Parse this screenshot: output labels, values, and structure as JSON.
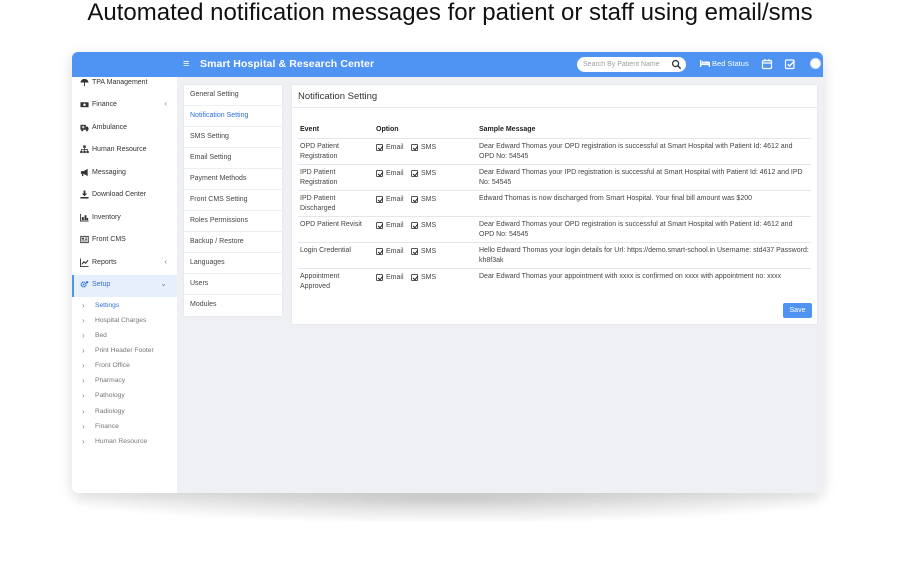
{
  "headline": "Automated notification messages for patient or staff using email/sms",
  "app": {
    "title": "Smart Hospital & Research Center",
    "search_placeholder": "Search By Patient Name",
    "bed_status": "Bed Status",
    "accent_color": "#4f94f3"
  },
  "sidebar": {
    "items": [
      {
        "label": "TPA Management",
        "icon": "umbrella-icon"
      },
      {
        "label": "Finance",
        "icon": "money-icon",
        "caret": "‹"
      },
      {
        "label": "Ambulance",
        "icon": "ambulance-icon"
      },
      {
        "label": "Human Resource",
        "icon": "sitemap-icon"
      },
      {
        "label": "Messaging",
        "icon": "bullhorn-icon"
      },
      {
        "label": "Download Center",
        "icon": "download-icon"
      },
      {
        "label": "Inventory",
        "icon": "inventory-icon"
      },
      {
        "label": "Front CMS",
        "icon": "newspaper-icon"
      },
      {
        "label": "Reports",
        "icon": "chart-icon",
        "caret": "‹"
      },
      {
        "label": "Setup",
        "icon": "gears-icon",
        "caret": "⌄"
      }
    ],
    "subitems": [
      "Settings",
      "Hospital Charges",
      "Bed",
      "Print Header Footer",
      "Front Office",
      "Pharmacy",
      "Pathology",
      "Radiology",
      "Finance",
      "Human Resource"
    ]
  },
  "settings_menu": [
    "General Setting",
    "Notification Setting",
    "SMS Setting",
    "Email Setting",
    "Payment Methods",
    "Front CMS Setting",
    "Roles Permissions",
    "Backup / Restore",
    "Languages",
    "Users",
    "Modules"
  ],
  "panel": {
    "title": "Notification Setting",
    "headers": {
      "event": "Event",
      "option": "Option",
      "sample": "Sample Message"
    },
    "email_label": "Email",
    "sms_label": "SMS",
    "save_label": "Save",
    "rows": [
      {
        "event": "OPD Patient Registration",
        "email": true,
        "sms": true,
        "message": "Dear Edward Thomas your OPD registration is successful at Smart Hospital with Patient Id: 4612 and OPD No: 54545"
      },
      {
        "event": "IPD Patient Registration",
        "email": true,
        "sms": true,
        "message": "Dear Edward Thomas your IPD registration is successful at Smart Hospital with Patient Id: 4612 and IPD No: 54545"
      },
      {
        "event": "IPD Patient Discharged",
        "email": true,
        "sms": true,
        "message": "Edward Thomas is now discharged from Smart Hospital. Your final bill amount was $200"
      },
      {
        "event": "OPD Patient Revisit",
        "email": true,
        "sms": true,
        "message": "Dear Edward Thomas your OPD registration is successful at Smart Hospital with Patient Id: 4612 and OPD No: 54545"
      },
      {
        "event": "Login Credential",
        "email": true,
        "sms": true,
        "message": "Hello Edward Thomas your login details for Url: https://demo.smart-school.in Username: std437 Password: kh8f3ak"
      },
      {
        "event": "Appointment Approved",
        "email": true,
        "sms": true,
        "message": "Dear Edward Thomas your appointment with xxxx is confirmed on xxxx with appointment no: xxxx"
      }
    ]
  }
}
